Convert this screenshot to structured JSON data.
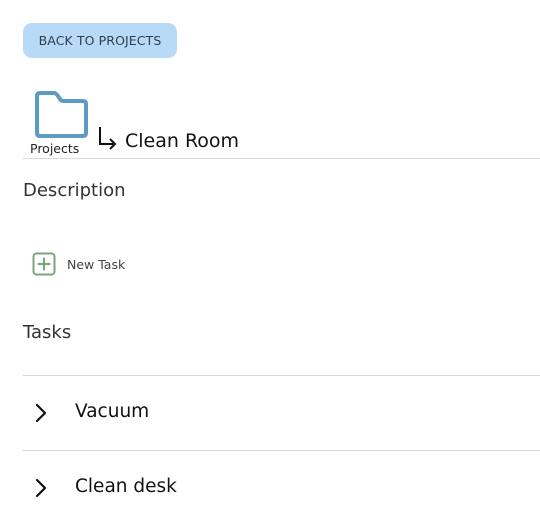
{
  "nav": {
    "back_label": "BACK TO PROJECTS"
  },
  "breadcrumb": {
    "folder_label": "Projects",
    "folder_icon": "folder-icon",
    "arrow_icon": "subdirectory-arrow-icon",
    "current": "Clean Room"
  },
  "description": {
    "heading": "Description"
  },
  "actions": {
    "new_task_label": "New Task",
    "new_task_icon": "plus-square-icon"
  },
  "tasks": {
    "heading": "Tasks",
    "items": [
      {
        "label": "Vacuum",
        "icon": "chevron-right-icon"
      },
      {
        "label": "Clean desk",
        "icon": "chevron-right-icon"
      }
    ]
  },
  "colors": {
    "back_button_bg": "#b9daf6",
    "folder_stroke": "#5b9cc4",
    "new_task_accent": "#7aa57f",
    "divider": "#d9d9d9"
  }
}
